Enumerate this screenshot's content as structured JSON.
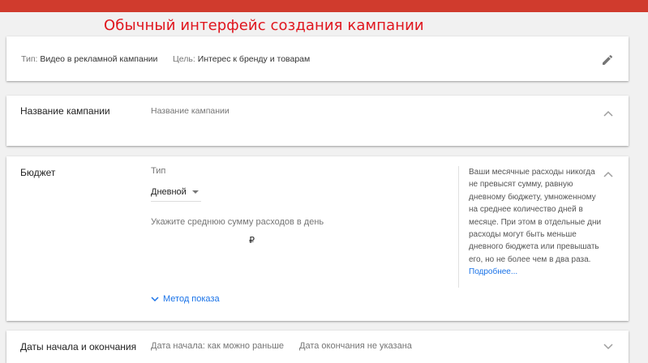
{
  "banner": "Обычный интерфейс создания кампании",
  "summary": {
    "type_label": "Тип:",
    "type_value": "Видео в рекламной кампании",
    "goal_label": "Цель:",
    "goal_value": "Интерес к бренду и товарам",
    "edit_icon": "pencil-icon"
  },
  "campaign_name": {
    "section_title": "Название кампании",
    "placeholder": "Название кампании"
  },
  "budget": {
    "section_title": "Бюджет",
    "type_label": "Тип",
    "type_value": "Дневной",
    "amount_hint": "Укажите среднюю сумму расходов в день",
    "currency": "₽",
    "help_text": "Ваши месячные расходы никогда не превысят сумму, равную дневному бюджету, умноженному на среднее количество дней в месяце. При этом в отдельные дни расходы могут быть меньше дневного бюджета или превышать его, но не более чем в два раза.",
    "help_link": "Подробнее...",
    "delivery_method": "Метод показа"
  },
  "dates": {
    "section_title": "Даты начала и окончания",
    "start": "Дата начала: как можно раньше",
    "end": "Дата окончания не указана"
  },
  "colors": {
    "topbar": "#d03b2d",
    "banner_text": "#e0151d",
    "link": "#1a73e8"
  }
}
